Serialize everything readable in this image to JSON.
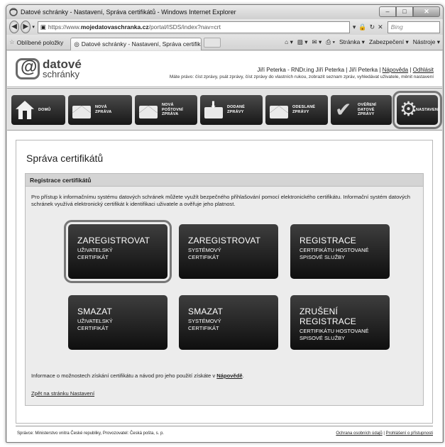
{
  "browser": {
    "window_title": "Datové schránky - Nastavení, Správa certifikátů - Windows Internet Explorer",
    "address_prefix": "https://www.",
    "address_host": "mojedatovaschranka.cz",
    "address_path": "/portal/ISDS/index?nav=crt",
    "search_placeholder": "Bing",
    "favorites_label": "Oblíbené položky",
    "tab_title": "Datové schránky - Nastavení, Správa certifikátů",
    "cmd_page": "Stránka ▾",
    "cmd_security": "Zabezpečení ▾",
    "cmd_tools": "Nástroje ▾"
  },
  "header": {
    "logo_line1": "datové",
    "logo_line2": "schránky",
    "user_text": "Jiří Peterka - RNDr.ing Jiří Peterka | Jiří Peterka | ",
    "help_link": "Nápověda",
    "sep": " | ",
    "logout_link": "Odhlásit",
    "rights_text": "Máte právo: číst zprávy, psát zprávy, číst zprávy do vlastních rukou, zobrazit seznam zpráv, vyhledávat uživatele, měnit nastavení"
  },
  "menu": [
    {
      "label": "DOMŮ"
    },
    {
      "label": "NOVÁ\nZPRÁVA"
    },
    {
      "label": "NOVÁ\nPOŠTOVNÍ\nZPRÁVA"
    },
    {
      "label": "DODANÉ\nZPRÁVY"
    },
    {
      "label": "ODESLANÉ\nZPRÁVY"
    },
    {
      "label": "OVĚŘENÍ\nDATOVÉ\nZPRÁVY"
    },
    {
      "label": "NASTAVENÍ"
    }
  ],
  "main": {
    "title": "Správa certifikátů",
    "panel_heading": "Registrace certifikátů",
    "intro": "Pro přístup k informačnímu systému datových schránek můžete využít bezpečného přihlašování pomocí elektronického certifikátu. Informační systém datových schránek využívá elektronický certifikát k identifikaci uživatele a ověřuje jeho platnost.",
    "buttons": [
      {
        "big": "ZAREGISTROVAT",
        "small": "UŽIVATELSKÝ\nCERTIFIKÁT"
      },
      {
        "big": "ZAREGISTROVAT",
        "small": "SYSTÉMOVÝ\nCERTIFIKÁT"
      },
      {
        "big": "REGISTRACE",
        "small": "CERTIFIKÁTU HOSTOVANÉ\nSPISOVÉ SLUŽBY"
      },
      {
        "big": "SMAZAT",
        "small": "UŽIVATELSKÝ\nCERTIFIKÁT"
      },
      {
        "big": "SMAZAT",
        "small": "SYSTÉMOVÝ\nCERTIFIKÁT"
      },
      {
        "big": "ZRUŠENÍ REGISTRACE",
        "small": "CERTIFIKÁTU HOSTOVANÉ\nSPISOVÉ SLUŽBY"
      }
    ],
    "help_text": "Informace o možnostech získání certifikátu a návod pro jeho použití získáte v ",
    "help_link": "Nápovědě",
    "help_end": ".",
    "back_link": "Zpět na stránku Nastavení"
  },
  "footer": {
    "left": "Správce: Ministerstvo vnitra České republiky, Provozovatel: Česká pošta, s. p.",
    "privacy_link": "Ochrana osobních údajů",
    "sep": " | ",
    "accessibility_link": "Prohlášení o přístupnosti"
  },
  "colors": {
    "button_dark": "#1a1a1a",
    "panel_bg": "#ececec",
    "highlight_outline": "#777777"
  }
}
